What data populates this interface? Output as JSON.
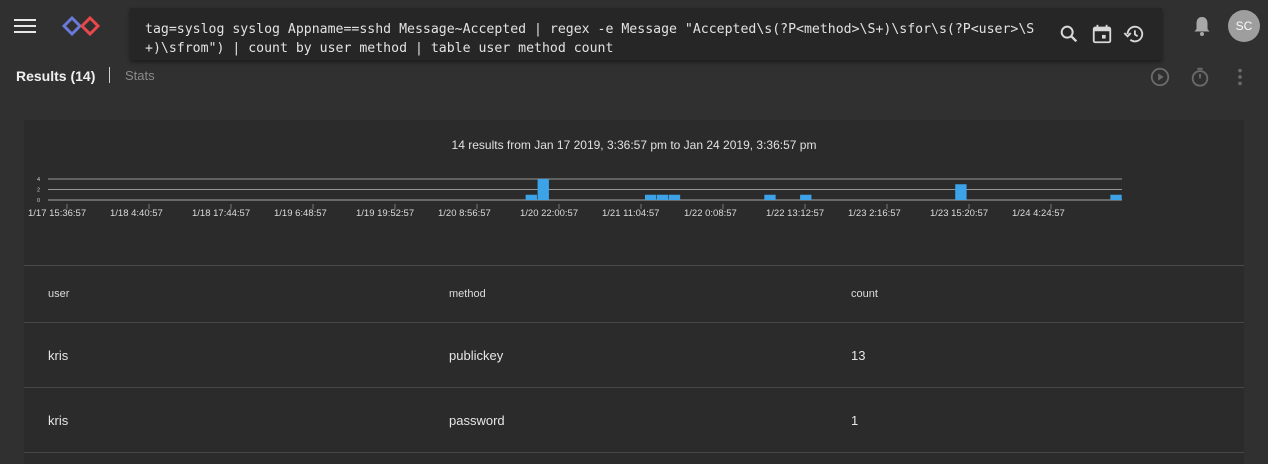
{
  "app": {
    "user_initials": "SC"
  },
  "query": {
    "text": "tag=syslog syslog Appname==sshd Message~Accepted | regex -e Message \"Accepted\\s(?P<method>\\S+)\\sfor\\s(?P<user>\\S+)\\sfrom\") | count by user method | table user method count"
  },
  "icons": {
    "menu": "menu-icon",
    "search": "search-icon",
    "calendar": "calendar-icon",
    "history": "history-icon",
    "notifications": "bell-icon",
    "play": "play-icon",
    "timer": "timer-icon",
    "more": "more-vert-icon"
  },
  "tabs": {
    "results_label": "Results (14)",
    "stats_label": "Stats"
  },
  "results": {
    "summary": "14 results from Jan 17 2019, 3:36:57 pm to Jan 24 2019, 3:36:57 pm"
  },
  "chart_data": {
    "type": "bar",
    "y_ticks": [
      "4",
      "2",
      "0"
    ],
    "ylim": [
      0,
      4
    ],
    "x_tick_labels": [
      "1/17 15:36:57",
      "1/18 4:40:57",
      "1/18 17:44:57",
      "1/19 6:48:57",
      "1/19 19:52:57",
      "1/20 8:56:57",
      "1/20 22:00:57",
      "1/21 11:04:57",
      "1/22 0:08:57",
      "1/22 13:12:57",
      "1/23 2:16:57",
      "1/23 15:20:57",
      "1/24 4:24:57"
    ],
    "bar_color": "#3da3e8",
    "bins": 90,
    "values": [
      0,
      0,
      0,
      0,
      0,
      0,
      0,
      0,
      0,
      0,
      0,
      0,
      0,
      0,
      0,
      0,
      0,
      0,
      0,
      0,
      0,
      0,
      0,
      0,
      0,
      0,
      0,
      0,
      0,
      0,
      0,
      0,
      0,
      0,
      0,
      0,
      0,
      0,
      0,
      0,
      1,
      4,
      0,
      0,
      0,
      0,
      0,
      0,
      0,
      0,
      1,
      1,
      1,
      0,
      0,
      0,
      0,
      0,
      0,
      0,
      1,
      0,
      0,
      1,
      0,
      0,
      0,
      0,
      0,
      0,
      0,
      0,
      0,
      0,
      0,
      0,
      3,
      0,
      0,
      0,
      0,
      0,
      0,
      0,
      0,
      0,
      0,
      0,
      0,
      1
    ]
  },
  "table": {
    "columns": [
      "user",
      "method",
      "count"
    ],
    "rows": [
      [
        "kris",
        "publickey",
        "13"
      ],
      [
        "kris",
        "password",
        "1"
      ]
    ]
  }
}
